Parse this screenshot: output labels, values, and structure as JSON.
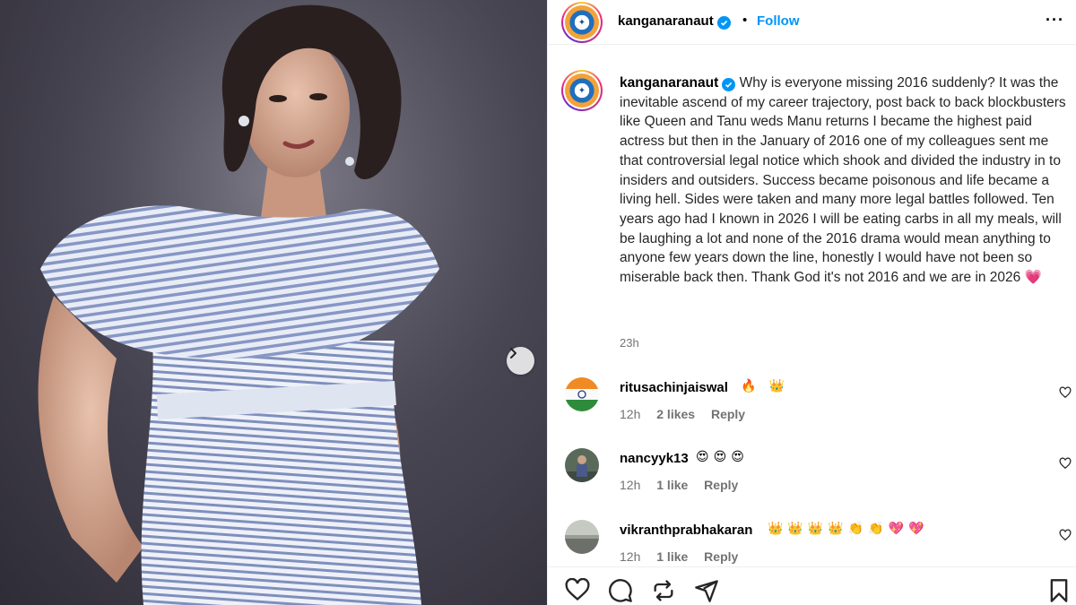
{
  "post": {
    "image_alt": "Woman in blue striped ruffle dress posing against dark backdrop",
    "next_icon": "chevron-right-icon"
  },
  "header": {
    "username": "kanganaranaut",
    "separator": "•",
    "follow_label": "Follow",
    "more_icon": "more-horizontal-icon",
    "more_label": "···"
  },
  "caption": {
    "username": "kanganaranaut",
    "text": "Why is everyone missing 2016 suddenly? It was the inevitable ascend of my career trajectory, post back to back blockbusters like Queen and Tanu weds Manu returns I became the highest paid actress but then in the January of 2016 one of my colleagues sent me that controversial legal notice which shook and divided the industry in to insiders and outsiders. Success became poisonous and life became a living hell. Sides were taken and many more legal battles followed. Ten years ago had I known in 2026 I will be eating carbs in all my meals, will be laughing a lot and none of the 2016 drama would mean anything to anyone few years down the line, honestly I would have not been so miserable back then. Thank God it's not 2016 and we are in 2026",
    "emoji": "💗",
    "time": "23h"
  },
  "comments": [
    {
      "username": "ritusachinjaiswal",
      "emojis": "🔥 👑",
      "time": "12h",
      "likes": "2 likes",
      "reply": "Reply"
    },
    {
      "username": "nancyyk13",
      "emojis": "😍😍😍",
      "time": "12h",
      "likes": "1 like",
      "reply": "Reply"
    },
    {
      "username": "vikranthprabhakaran",
      "emojis": "👑👑👑👑👏👏💖💖",
      "time": "12h",
      "likes": "1 like",
      "reply": "Reply"
    }
  ],
  "actions": {
    "like_icon": "heart-icon",
    "comment_icon": "comment-icon",
    "repost_icon": "repost-icon",
    "share_icon": "send-icon",
    "save_icon": "bookmark-icon"
  },
  "colors": {
    "accent_blue": "#0095f6",
    "muted_text": "#737373",
    "text": "#262626"
  }
}
